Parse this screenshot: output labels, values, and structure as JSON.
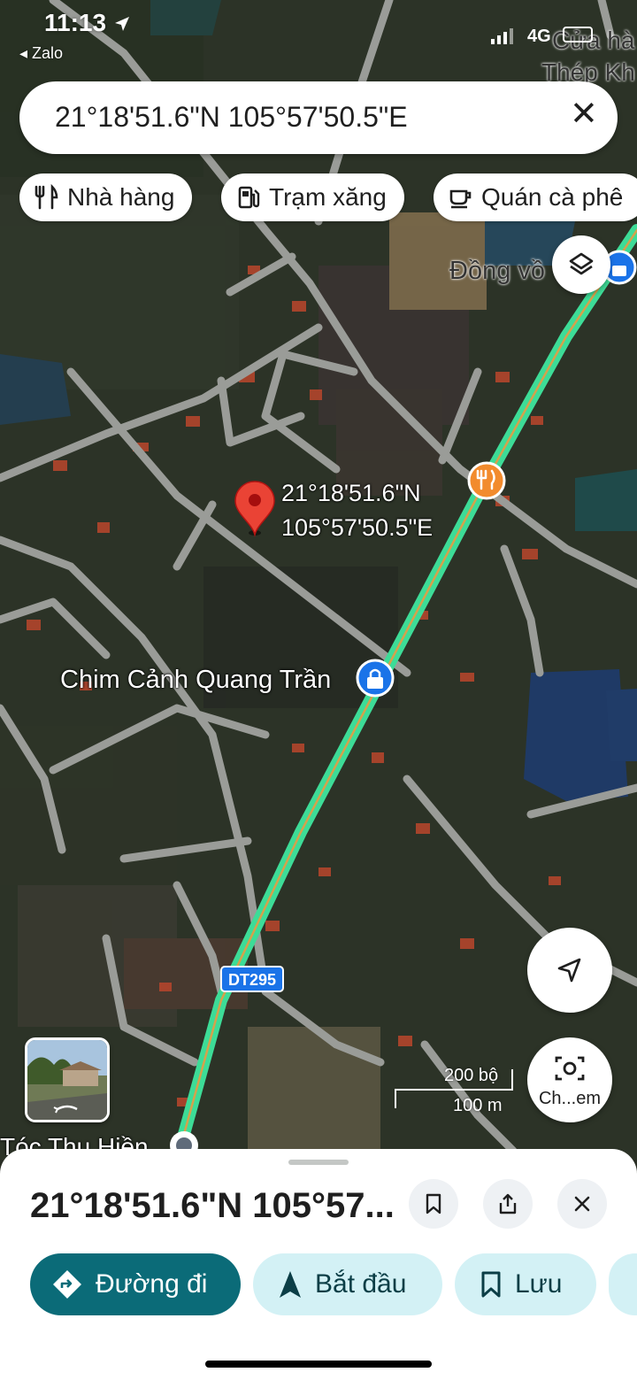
{
  "status_bar": {
    "time": "11:13",
    "back_app": "◂ Zalo",
    "network": "4G"
  },
  "search": {
    "query": "21°18'51.6\"N 105°57'50.5\"E",
    "clear_icon": "close-icon"
  },
  "chips": [
    {
      "label": "Nhà hàng",
      "icon": "restaurant-icon"
    },
    {
      "label": "Trạm xăng",
      "icon": "gas-station-icon"
    },
    {
      "label": "Quán cà phê",
      "icon": "coffee-icon"
    }
  ],
  "map": {
    "corner_labels": {
      "top_right_1": "Cửa hà",
      "top_right_2": "Thép Kh"
    },
    "pin": {
      "lat": "21°18'51.6\"N",
      "lng": "105°57'50.5\"E"
    },
    "places": {
      "dong": "Đồng vồ",
      "chim": "Chim Cảnh Quang Trần",
      "toc": "Tóc Thu Hiền"
    },
    "road_label": "DT295",
    "scale": {
      "feet": "200 bộ",
      "meters": "100 m"
    },
    "colors": {
      "highway": "#3ddc97",
      "highway_center": "#d4a24c",
      "road": "#9a9c98",
      "pin": "#ea4335",
      "restaurant_marker": "#f28b2d",
      "shop_marker": "#1a73e8"
    }
  },
  "controls": {
    "layers_icon": "layers-icon",
    "location_icon": "navigation-arrow-icon",
    "lens_label": "Ch...em"
  },
  "place_sheet": {
    "title": "21°18'51.6\"N 105°57...",
    "actions": [
      {
        "label": "Đường đi",
        "icon": "directions-icon",
        "style": "primary"
      },
      {
        "label": "Bắt đầu",
        "icon": "navigation-icon",
        "style": "tonal"
      },
      {
        "label": "Lưu",
        "icon": "bookmark-icon",
        "style": "tonal"
      }
    ],
    "colors": {
      "primary": "#0b6b78",
      "tonal": "#d3f1f5",
      "tonal_text": "#0b3e46"
    }
  }
}
